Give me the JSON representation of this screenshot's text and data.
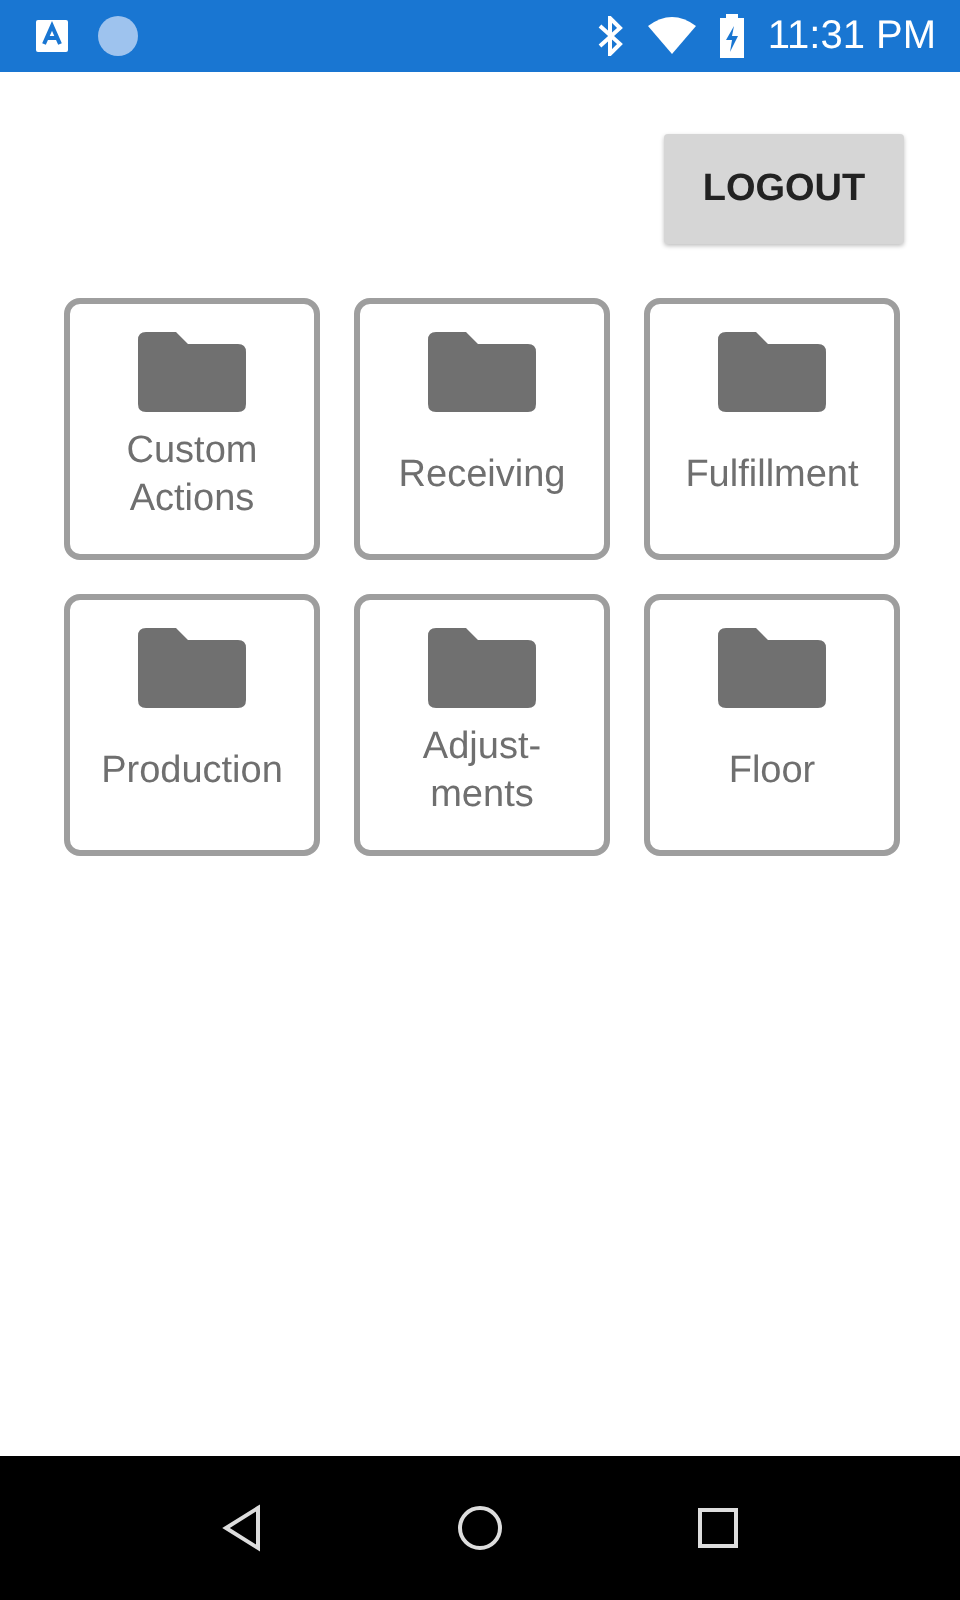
{
  "status_bar": {
    "time": "11:31 PM"
  },
  "logout_button": {
    "label": "LOGOUT"
  },
  "tiles": [
    {
      "label": "Custom\nActions"
    },
    {
      "label": "Receiving"
    },
    {
      "label": "Fulfillment"
    },
    {
      "label": "Production"
    },
    {
      "label": "Adjust-\nments"
    },
    {
      "label": "Floor"
    }
  ]
}
